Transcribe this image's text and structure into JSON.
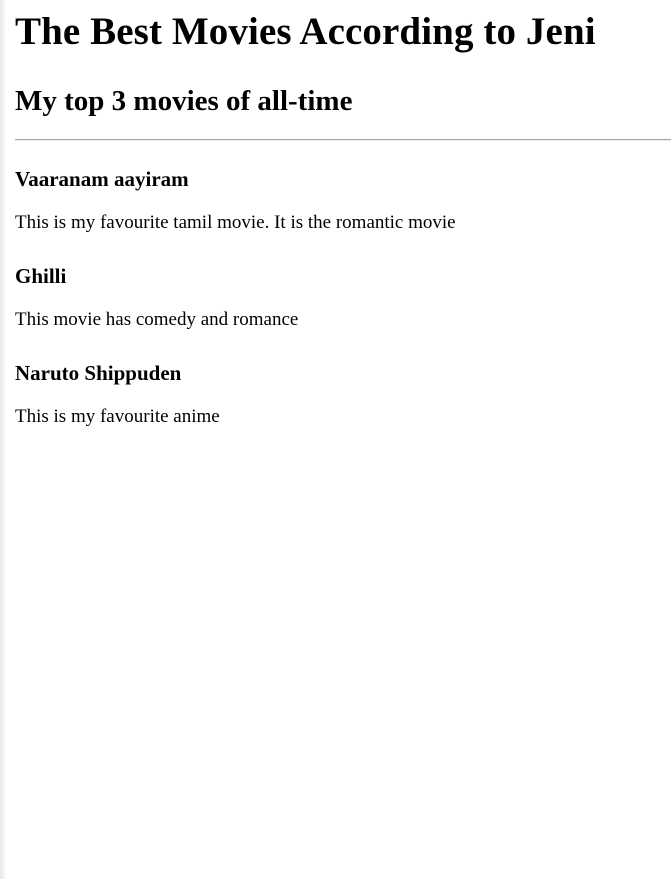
{
  "page": {
    "title": "The Best Movies According to Jeni",
    "subtitle": "My top 3 movies of all-time"
  },
  "movies": [
    {
      "title": "Vaaranam aayiram",
      "description": "This is my favourite tamil movie. It is the romantic movie"
    },
    {
      "title": "Ghilli",
      "description": "This movie has comedy and romance"
    },
    {
      "title": "Naruto Shippuden",
      "description": "This is my favourite anime"
    }
  ]
}
